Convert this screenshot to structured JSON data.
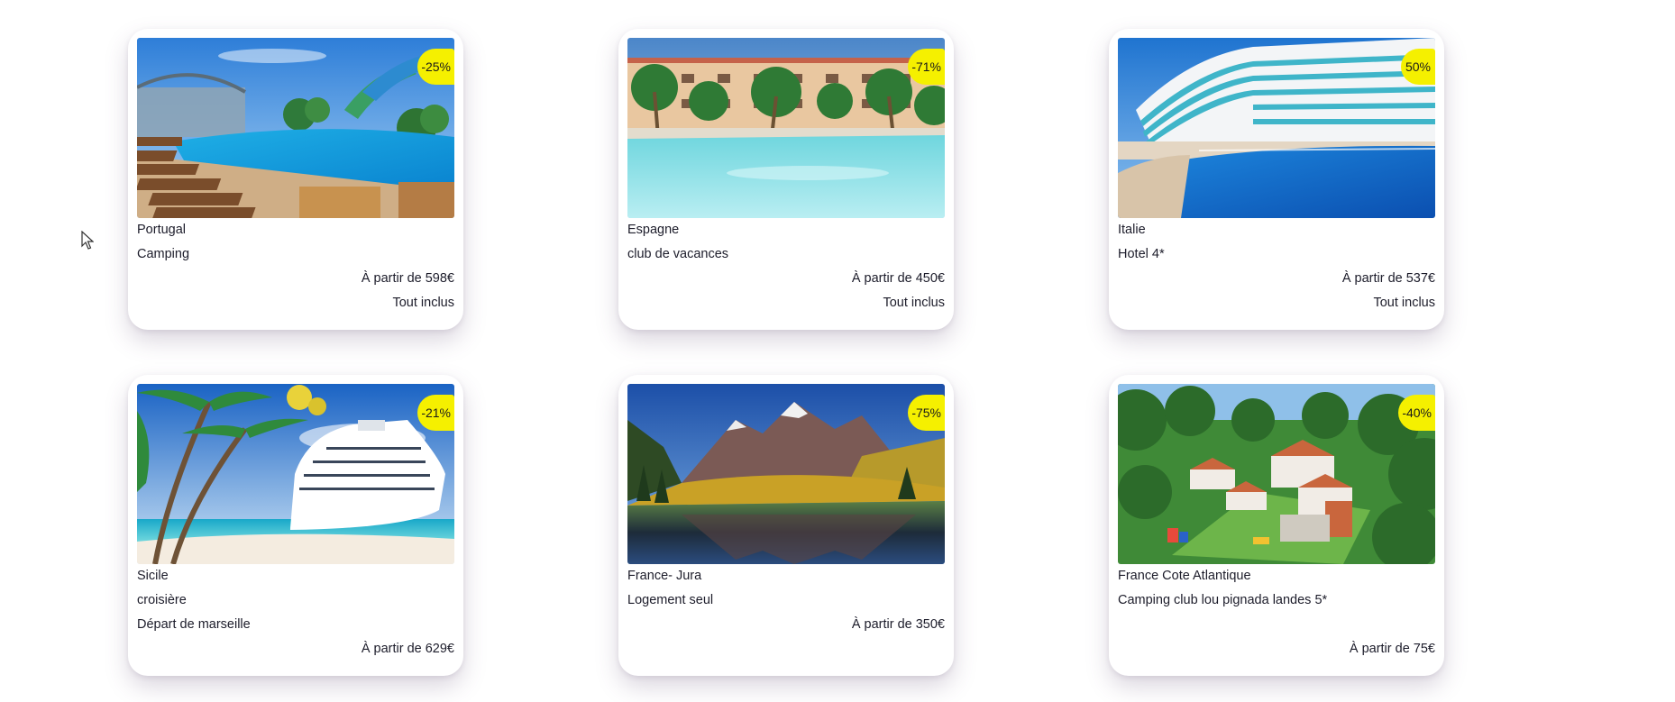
{
  "cards": [
    {
      "country": "Portugal",
      "type": "Camping",
      "extra": "",
      "price": "À partir de 598€",
      "inclusion": "Tout inclus",
      "discount": "-25%",
      "image": "pool-resort-photo"
    },
    {
      "country": "Espagne",
      "type": "club de vacances",
      "extra": "",
      "price": "À partir de 450€",
      "inclusion": "Tout inclus",
      "discount": "-71%",
      "image": "palm-pool-photo"
    },
    {
      "country": "Italie",
      "type": "Hotel 4*",
      "extra": "",
      "price": "À partir de 537€",
      "inclusion": "Tout inclus",
      "discount": "50%",
      "image": "hotel-pool-photo"
    },
    {
      "country": "Sicile",
      "type": "croisière",
      "extra": "Départ de marseille",
      "price": "À partir de 629€",
      "inclusion": "",
      "discount": "-21%",
      "image": "cruise-ship-photo"
    },
    {
      "country": "France- Jura",
      "type": "Logement seul",
      "extra": "",
      "price": "À partir de 350€",
      "inclusion": "",
      "discount": "-75%",
      "image": "mountain-lake-photo"
    },
    {
      "country": "France Cote Atlantique",
      "type": "Camping club lou pignada landes 5*",
      "extra": "",
      "price": "À partir de 75€",
      "inclusion": "",
      "discount": "-40%",
      "image": "campsite-aerial-photo"
    }
  ],
  "colors": {
    "badge": "#f5f000",
    "text": "#1c1c2a"
  }
}
